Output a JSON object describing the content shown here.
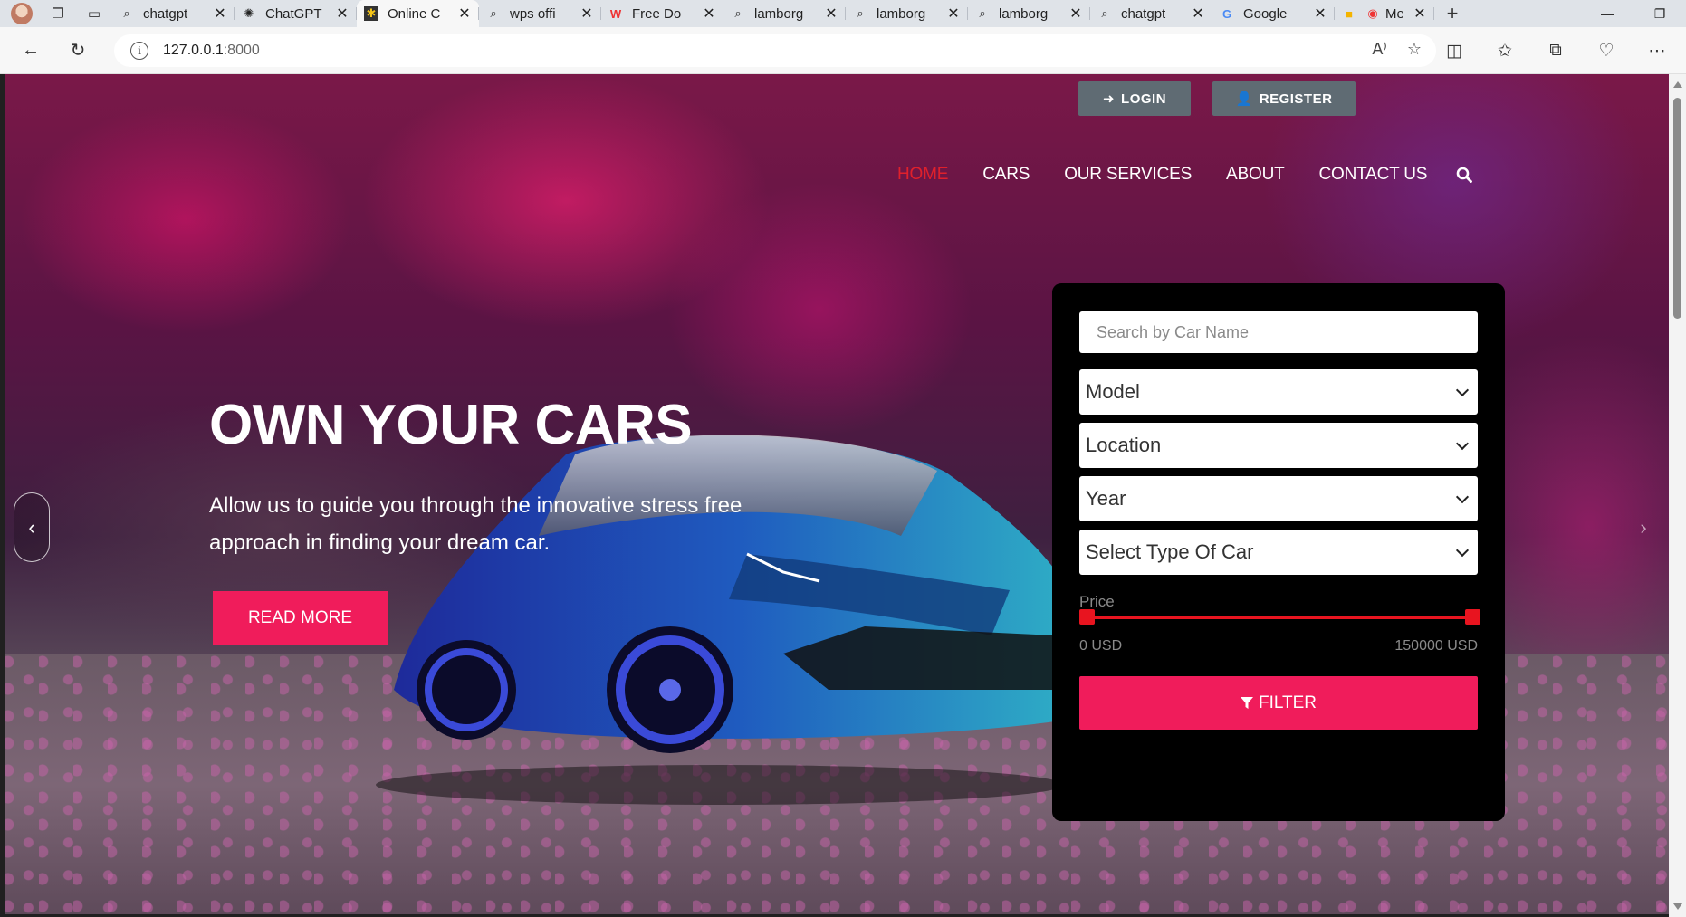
{
  "browser": {
    "tabs": [
      {
        "title": "chatgpt",
        "icon": "search-icon"
      },
      {
        "title": "ChatGPT",
        "icon": "chatgpt-icon"
      },
      {
        "title": "Online C",
        "icon": "site-icon",
        "active": true
      },
      {
        "title": "wps offi",
        "icon": "search-icon"
      },
      {
        "title": "Free Do",
        "icon": "wps-icon"
      },
      {
        "title": "lamborg",
        "icon": "search-icon"
      },
      {
        "title": "lamborg",
        "icon": "search-icon"
      },
      {
        "title": "lamborg",
        "icon": "search-icon"
      },
      {
        "title": "chatgpt",
        "icon": "search-icon"
      },
      {
        "title": "Google",
        "icon": "google-icon"
      },
      {
        "title": "Me",
        "icon": "google-keep-icon"
      }
    ],
    "url_host": "127.0.0.1",
    "url_port": ":8000"
  },
  "auth": {
    "login_label": "LOGIN",
    "register_label": "REGISTER"
  },
  "nav": {
    "home": "HOME",
    "cars": "CARS",
    "services": "OUR SERVICES",
    "about": "ABOUT",
    "contact": "CONTACT US"
  },
  "hero": {
    "title": "OWN YOUR CARS",
    "subtitle": "Allow us to guide you through the innovative stress free approach in finding your dream car.",
    "cta_label": "READ MORE"
  },
  "filter": {
    "search_placeholder": "Search by Car Name",
    "model": "Model",
    "location": "Location",
    "year": "Year",
    "type": "Select Type Of Car",
    "price_label": "Price",
    "price_min": "0 USD",
    "price_max": "150000 USD",
    "button_label": "FILTER"
  },
  "colors": {
    "accent": "#f01c5b",
    "nav_active": "#e0202b",
    "slider": "#e8141f",
    "auth_button": "#5f6b73",
    "panel": "#000000"
  }
}
